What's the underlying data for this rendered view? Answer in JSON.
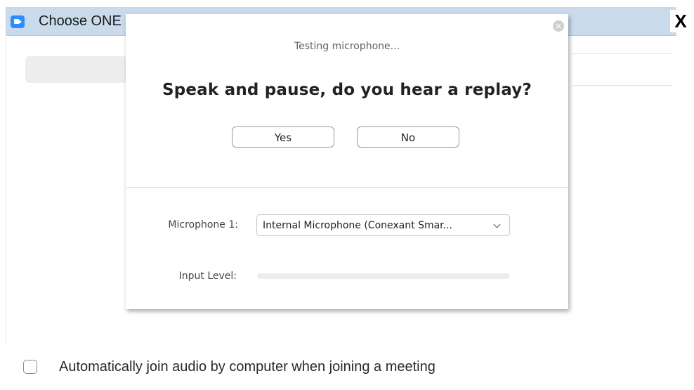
{
  "window": {
    "title": "Choose ONE",
    "close_label": "X"
  },
  "dialog": {
    "close_label": "×",
    "testing_label": "Testing microphone...",
    "headline": "Speak and pause, do you hear a replay?",
    "yes_label": "Yes",
    "no_label": "No",
    "microphone_label": "Microphone 1:",
    "microphone_value": "Internal Microphone (Conexant Smar...",
    "input_level_label": "Input Level:",
    "input_level": 0
  },
  "footer": {
    "auto_join_label": "Automatically join audio by computer when joining a meeting",
    "auto_join_checked": false
  },
  "colors": {
    "accent": "#2d8cff",
    "titlebar": "#c9dbeb"
  }
}
